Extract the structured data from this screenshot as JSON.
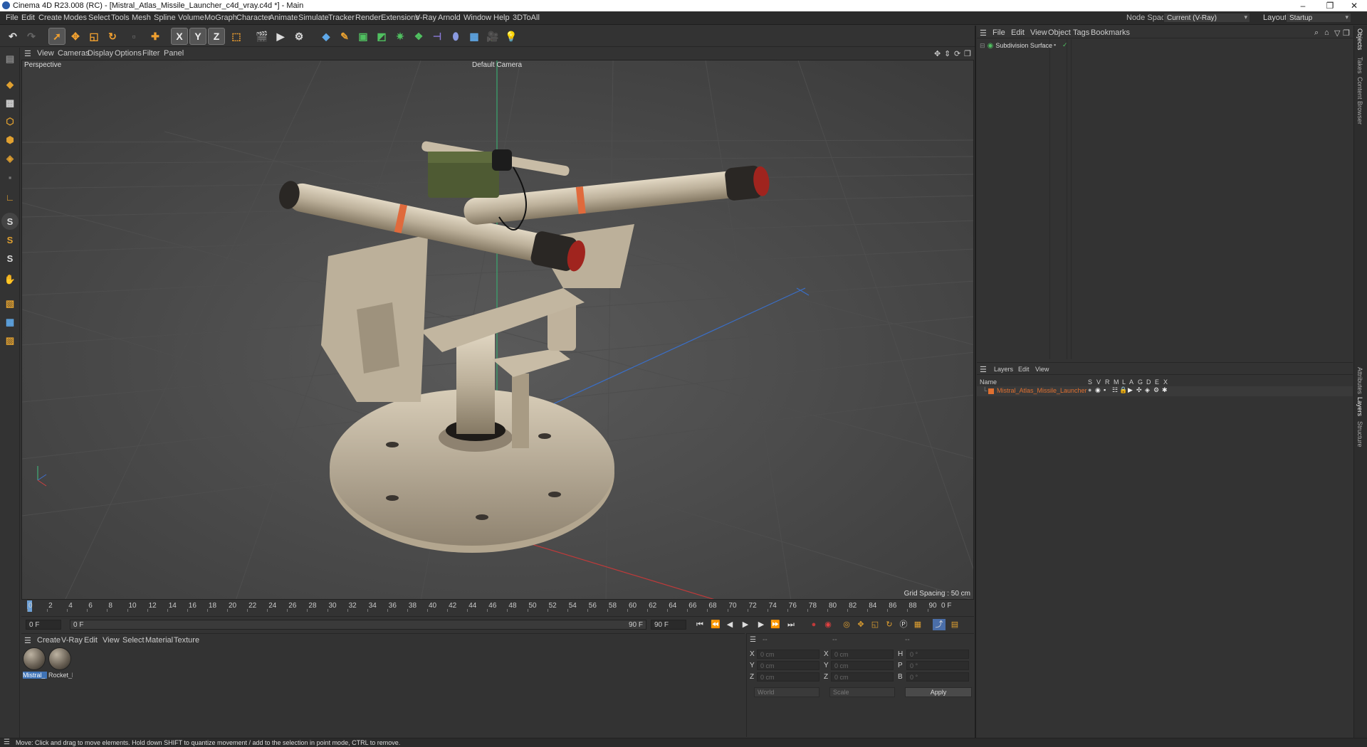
{
  "window": {
    "title": "Cinema 4D R23.008 (RC) - [Mistral_Atlas_Missile_Launcher_c4d_vray.c4d *] - Main"
  },
  "menu": [
    "File",
    "Edit",
    "Create",
    "Modes",
    "Select",
    "Tools",
    "Mesh",
    "Spline",
    "Volume",
    "MoGraph",
    "Character",
    "Animate",
    "Simulate",
    "Tracker",
    "Render",
    "Extensions",
    "V-Ray",
    "Arnold",
    "Window",
    "Help",
    "3DToAll"
  ],
  "node_space": {
    "label": "Node Space:",
    "value": "Current (V-Ray)"
  },
  "layout": {
    "label": "Layout:",
    "value": "Startup"
  },
  "toolbar_axes": [
    "X",
    "Y",
    "Z"
  ],
  "viewport": {
    "menu": [
      "View",
      "Cameras",
      "Display",
      "Options",
      "Filter",
      "Panel"
    ],
    "label": "Perspective",
    "camera": "Default Camera",
    "grid_spacing": "Grid Spacing : 50 cm"
  },
  "timeline": {
    "ticks": [
      "0",
      "2",
      "4",
      "6",
      "8",
      "10",
      "12",
      "14",
      "16",
      "18",
      "20",
      "22",
      "24",
      "26",
      "28",
      "30",
      "32",
      "34",
      "36",
      "38",
      "40",
      "42",
      "44",
      "46",
      "48",
      "50",
      "52",
      "54",
      "56",
      "58",
      "60",
      "62",
      "64",
      "66",
      "68",
      "70",
      "72",
      "74",
      "76",
      "78",
      "80",
      "82",
      "84",
      "86",
      "88",
      "90"
    ],
    "current_frame": "0 F",
    "start_frame": "0 F",
    "range_start": "0 F",
    "range_end": "90 F",
    "end_frame": "90 F"
  },
  "material_manager": {
    "menu": [
      "Create",
      "V-Ray",
      "Edit",
      "View",
      "Select",
      "Material",
      "Texture"
    ],
    "materials": [
      {
        "name": "Mistral_",
        "selected": true
      },
      {
        "name": "Rocket_l",
        "selected": false
      }
    ]
  },
  "coordinates": {
    "col_headers": [
      "--",
      "--",
      "--"
    ],
    "rows": [
      {
        "a": "X",
        "av": "0 cm",
        "b": "X",
        "bv": "0 cm",
        "c": "H",
        "cv": "0 °"
      },
      {
        "a": "Y",
        "av": "0 cm",
        "b": "Y",
        "bv": "0 cm",
        "c": "P",
        "cv": "0 °"
      },
      {
        "a": "Z",
        "av": "0 cm",
        "b": "Z",
        "bv": "0 cm",
        "c": "B",
        "cv": "0 °"
      }
    ],
    "mode": "World",
    "type": "Scale",
    "apply": "Apply"
  },
  "objects": {
    "menu": [
      "File",
      "Edit",
      "View",
      "Object",
      "Tags",
      "Bookmarks"
    ],
    "items": [
      {
        "name": "Subdivision Surface"
      }
    ]
  },
  "layers": {
    "menu": [
      "Layers",
      "Edit",
      "View"
    ],
    "columns": [
      "Name",
      "S",
      "V",
      "R",
      "M",
      "L",
      "A",
      "G",
      "D",
      "E",
      "X"
    ],
    "items": [
      {
        "name": "Mistral_Atlas_Missile_Launcher",
        "color": "#e07030"
      }
    ]
  },
  "side_tabs": [
    "Objects",
    "Takes",
    "Content Browser",
    "Attributes",
    "Layers",
    "Structure"
  ],
  "status": "Move: Click and drag to move elements. Hold down SHIFT to quantize movement / add to the selection in point mode, CTRL to remove.",
  "colors": {
    "accent": "#3f73b6",
    "layer": "#e07030",
    "axis_x": "#d04040",
    "axis_y": "#40c080",
    "axis_z": "#4070d0"
  }
}
